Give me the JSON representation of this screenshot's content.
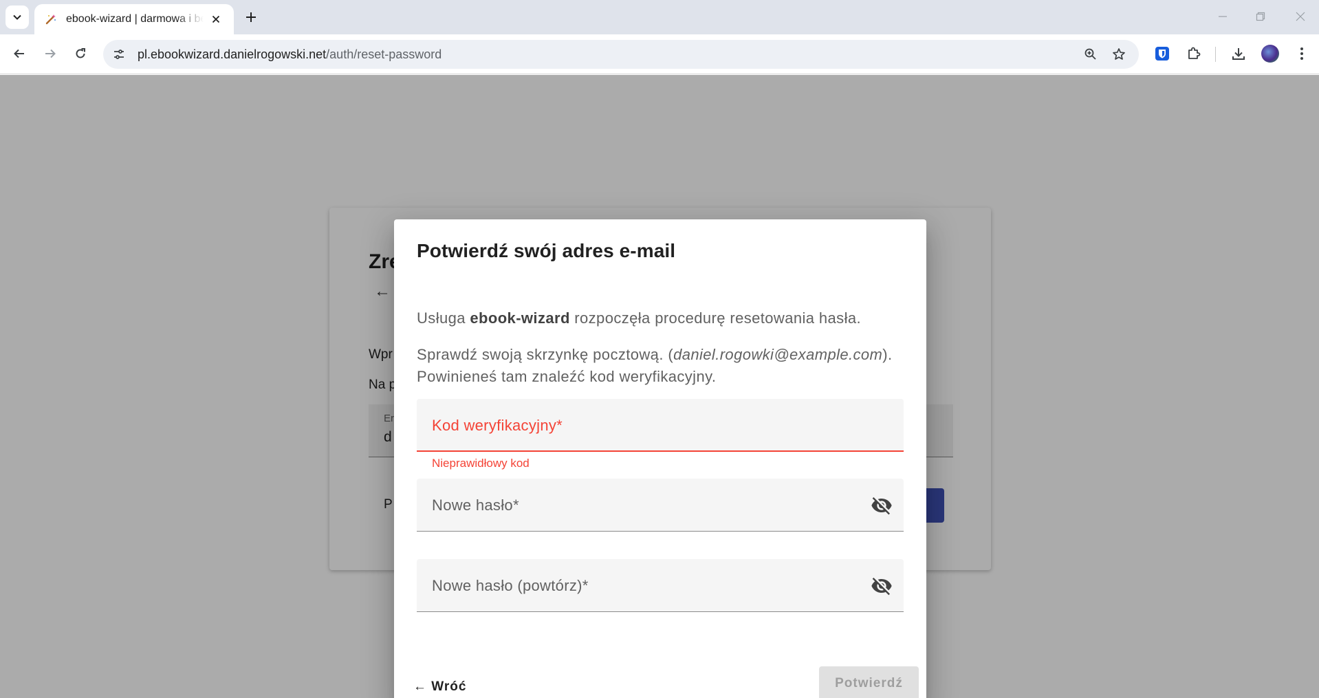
{
  "browser": {
    "tab_title": "ebook-wizard | darmowa i bezpłatna",
    "url_host": "pl.ebookwizard.danielrogowski.net",
    "url_path": "/auth/reset-password"
  },
  "background_page": {
    "title": "Zre",
    "back_arrow": "←",
    "text1": "Wpr",
    "text2": "Na p",
    "field_label": "Er",
    "field_value": "d",
    "link_text": "P"
  },
  "dialog": {
    "title": "Potwierdź swój adres e-mail",
    "p1_prefix": "Usługa ",
    "p1_service": "ebook-wizard",
    "p1_suffix": " rozpoczęła procedurę resetowania hasła.",
    "p2_prefix": "Sprawdź swoją skrzynkę pocztową. (",
    "p2_email": "daniel.rogowki@example.com",
    "p2_suffix": ").",
    "p3": "Powinieneś tam znaleźć kod weryfikacyjny.",
    "code_label": "Kod weryfikacyjny*",
    "code_error": "Nieprawidłowy kod",
    "password_label": "Nowe hasło*",
    "password_repeat_label": "Nowe hasło (powtórz)*",
    "back_label": "← Wróć",
    "confirm_label": "Potwierdź"
  },
  "colors": {
    "error": "#f44336",
    "primary": "#3f51b5",
    "disabled_bg": "#e0e0e0"
  }
}
